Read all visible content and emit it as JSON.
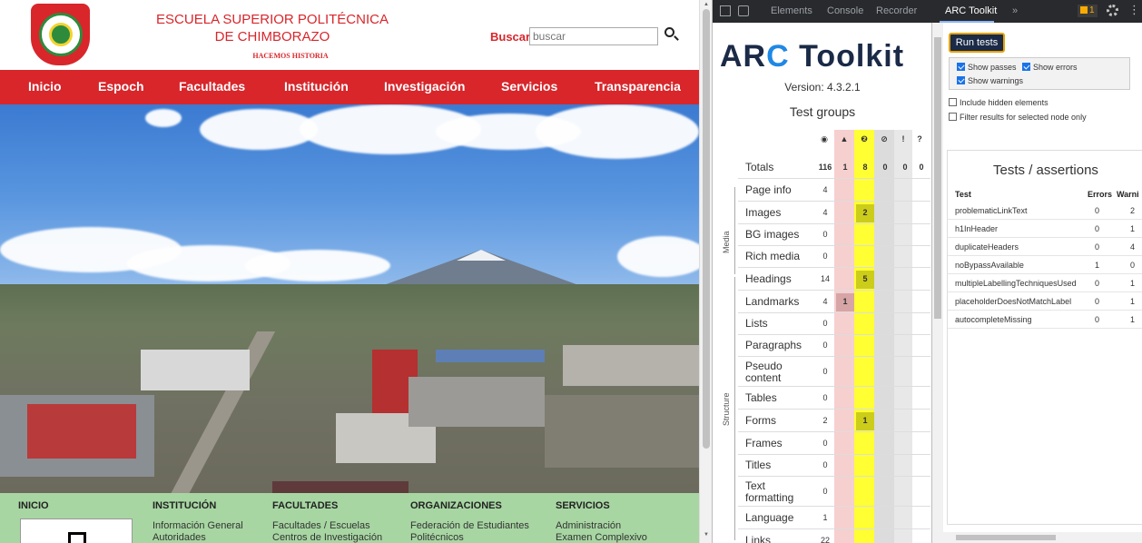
{
  "site": {
    "school_name": "ESCUELA SUPERIOR POLITÉCNICA DE CHIMBORAZO",
    "motto": "HACEMOS HISTORIA",
    "search_label": "Buscar:",
    "search_placeholder": "buscar",
    "nav": [
      "Inicio",
      "Espoch",
      "Facultades",
      "Institución",
      "Investigación",
      "Servicios",
      "Transparencia"
    ],
    "footer": {
      "headings": [
        "INICIO",
        "INSTITUCIÓN",
        "FACULTADES",
        "ORGANIZACIONES",
        "SERVICIOS"
      ],
      "institucion_links": [
        "Información General",
        "Autoridades"
      ],
      "facultades_links": [
        "Facultades / Escuelas",
        "Centros de Investigación"
      ],
      "organizaciones_links": [
        "Federación de Estudiantes",
        "Politécnicos"
      ],
      "servicios_links": [
        "Administración",
        "Examen Complexivo"
      ]
    }
  },
  "devtools": {
    "tabs": [
      "Elements",
      "Console",
      "Recorder",
      "ARC Toolkit"
    ],
    "active_tab": "ARC Toolkit",
    "more_tabs": "»",
    "issues_count": "1"
  },
  "arc": {
    "logo_prefix": "AR",
    "logo_c": "C",
    "logo_suffix": " Toolkit",
    "version": "Version: 4.3.2.1",
    "test_groups_title": "Test groups",
    "column_icons": [
      "eye-icon",
      "warning-triangle-icon",
      "question-circle-icon",
      "hidden-eye-icon",
      "exclamation-icon",
      "question-mark-icon"
    ],
    "column_glyphs": [
      "◉",
      "▲",
      "❷",
      "⊘",
      "!",
      "?"
    ],
    "side_labels": [
      "Media",
      "Structure"
    ],
    "rows": [
      {
        "label": "Totals",
        "values": [
          "116",
          "1",
          "8",
          "0",
          "0",
          "0"
        ],
        "bold": true
      },
      {
        "label": "Page info",
        "values": [
          "4",
          "",
          "",
          "",
          "",
          ""
        ]
      },
      {
        "label": "Images",
        "values": [
          "4",
          "",
          "2",
          "",
          "",
          ""
        ]
      },
      {
        "label": "BG images",
        "values": [
          "0",
          "",
          "",
          "",
          "",
          ""
        ]
      },
      {
        "label": "Rich media",
        "values": [
          "0",
          "",
          "",
          "",
          "",
          ""
        ]
      },
      {
        "label": "Headings",
        "values": [
          "14",
          "",
          "5",
          "",
          "",
          ""
        ]
      },
      {
        "label": "Landmarks",
        "values": [
          "4",
          "1",
          "",
          "",
          "",
          ""
        ]
      },
      {
        "label": "Lists",
        "values": [
          "0",
          "",
          "",
          "",
          "",
          ""
        ]
      },
      {
        "label": "Paragraphs",
        "values": [
          "0",
          "",
          "",
          "",
          "",
          ""
        ]
      },
      {
        "label": "Pseudo content",
        "values": [
          "0",
          "",
          "",
          "",
          "",
          ""
        ]
      },
      {
        "label": "Tables",
        "values": [
          "0",
          "",
          "",
          "",
          "",
          ""
        ]
      },
      {
        "label": "Forms",
        "values": [
          "2",
          "",
          "1",
          "",
          "",
          ""
        ]
      },
      {
        "label": "Frames",
        "values": [
          "0",
          "",
          "",
          "",
          "",
          ""
        ]
      },
      {
        "label": "Titles",
        "values": [
          "0",
          "",
          "",
          "",
          "",
          ""
        ]
      },
      {
        "label": "Text formatting",
        "values": [
          "0",
          "",
          "",
          "",
          "",
          ""
        ]
      },
      {
        "label": "Language",
        "values": [
          "1",
          "",
          "",
          "",
          "",
          ""
        ]
      },
      {
        "label": "Links",
        "values": [
          "22",
          "",
          "",
          "",
          "",
          ""
        ]
      }
    ],
    "run_tests": "Run tests",
    "options": {
      "show_passes": "Show passes",
      "show_errors": "Show errors",
      "show_warnings": "Show warnings",
      "include_hidden": "Include hidden elements",
      "filter_selected": "Filter results for selected node only"
    },
    "tests_title": "Tests / assertions",
    "tests_headers": [
      "Test",
      "Errors",
      "Warni"
    ],
    "tests": [
      {
        "name": "problematicLinkText",
        "errors": "0",
        "warnings": "2"
      },
      {
        "name": "h1InHeader",
        "errors": "0",
        "warnings": "1"
      },
      {
        "name": "duplicateHeaders",
        "errors": "0",
        "warnings": "4"
      },
      {
        "name": "noBypassAvailable",
        "errors": "1",
        "warnings": "0"
      },
      {
        "name": "multipleLabellingTechniquesUsed",
        "errors": "0",
        "warnings": "1"
      },
      {
        "name": "placeholderDoesNotMatchLabel",
        "errors": "0",
        "warnings": "1"
      },
      {
        "name": "autocompleteMissing",
        "errors": "0",
        "warnings": "1"
      }
    ]
  }
}
